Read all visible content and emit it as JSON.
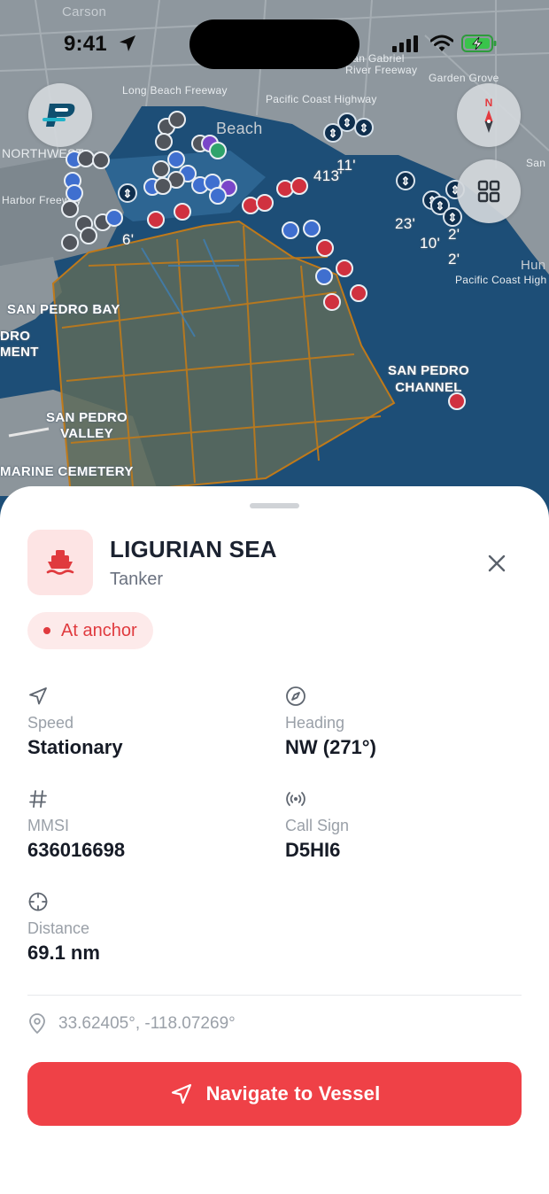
{
  "status_bar": {
    "time": "9:41"
  },
  "map": {
    "labels": {
      "carson": "Carson",
      "long_beach_freeway": "Long Beach Freeway",
      "pacific_coast_highway": "Pacific Coast Highway",
      "san_gabriel_river_freeway": "San Gabriel River Freeway",
      "garden_grove": "Garden Grove",
      "northwest": "NORTHWEST",
      "harbor_freeway": "Harbor Freeway",
      "beach": "Beach",
      "san": "San",
      "san_pedro_bay": "SAN PEDRO BAY",
      "dro": "DRO",
      "ment": "MENT",
      "san_pedro_valley": "SAN PEDRO VALLEY",
      "marine_cemetery": "MARINE CEMETERY",
      "san_pedro_channel": "SAN PEDRO CHANNEL",
      "pacific_coast_highway_2": "Pacific Coast High",
      "hun": "Hun",
      "depth_6": "6'",
      "depth_413": "413'",
      "depth_11": "11'",
      "depth_23": "23'",
      "depth_10": "10'",
      "depth_2a": "2'",
      "depth_2b": "2'"
    },
    "buttons": {
      "logo": "logo-icon",
      "compass": "compass-icon",
      "compass_north": "N",
      "layers": "grid-icon"
    }
  },
  "vessel": {
    "name": "LIGURIAN SEA",
    "type": "Tanker",
    "status": "At anchor",
    "status_color": "#e03a3e",
    "fields": {
      "speed": {
        "label": "Speed",
        "value": "Stationary"
      },
      "heading": {
        "label": "Heading",
        "value": "NW (271°)"
      },
      "mmsi": {
        "label": "MMSI",
        "value": "636016698"
      },
      "call_sign": {
        "label": "Call Sign",
        "value": "D5HI6"
      },
      "distance": {
        "label": "Distance",
        "value": "69.1 nm"
      }
    },
    "coordinates": "33.62405°, -118.07269°"
  },
  "actions": {
    "navigate": "Navigate to Vessel"
  },
  "colors": {
    "accent": "#ef4147",
    "ocean": "#1d4e77",
    "land": "#8d959b",
    "text": "#161b26",
    "muted": "#9aa0a8"
  }
}
